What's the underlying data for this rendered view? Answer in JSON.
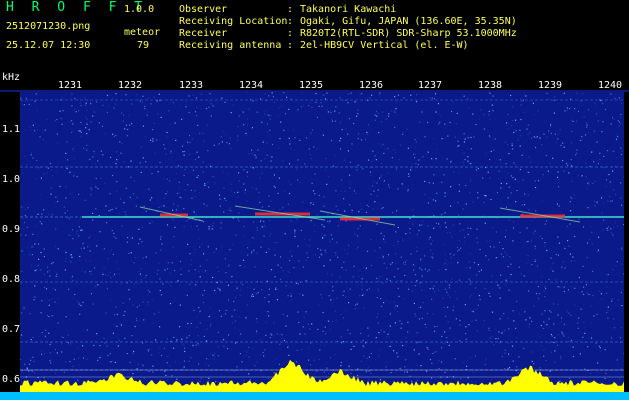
{
  "header": {
    "app_name": "H R O F F T",
    "version": "1.0.0",
    "filename": "2512071230.png",
    "mode_label": "meteor",
    "datetime": "25.12.07 12:30",
    "count": "79",
    "info": [
      {
        "label": "Observer",
        "value": "Takanori Kawachi"
      },
      {
        "label": "Receiving Location",
        "value": "Ogaki, Gifu, JAPAN (136.60E, 35.35N)"
      },
      {
        "label": "Receiver",
        "value": "R820T2(RTL-SDR) SDR-Sharp 53.1000MHz"
      },
      {
        "label": "Receiving antenna",
        "value": "2el-HB9CV Vertical (el. E-W)"
      }
    ]
  },
  "axes": {
    "unit": "kHz",
    "time_ticks": [
      "1231",
      "1232",
      "1233",
      "1234",
      "1235",
      "1236",
      "1237",
      "1238",
      "1239",
      "1240"
    ],
    "freq_ticks": [
      "1.1",
      "1.0",
      "0.9",
      "0.8",
      "0.7",
      "0.6"
    ]
  },
  "colors": {
    "background": "#000000",
    "header_text": "#ffff55",
    "app_name": "#00ff66",
    "waterfall_bg": "#0a1a8a",
    "signal_line": "#40e0d0",
    "meteor_echo": "#ff3030",
    "activity": "#ffff00",
    "baseline": "#00bfff"
  }
}
